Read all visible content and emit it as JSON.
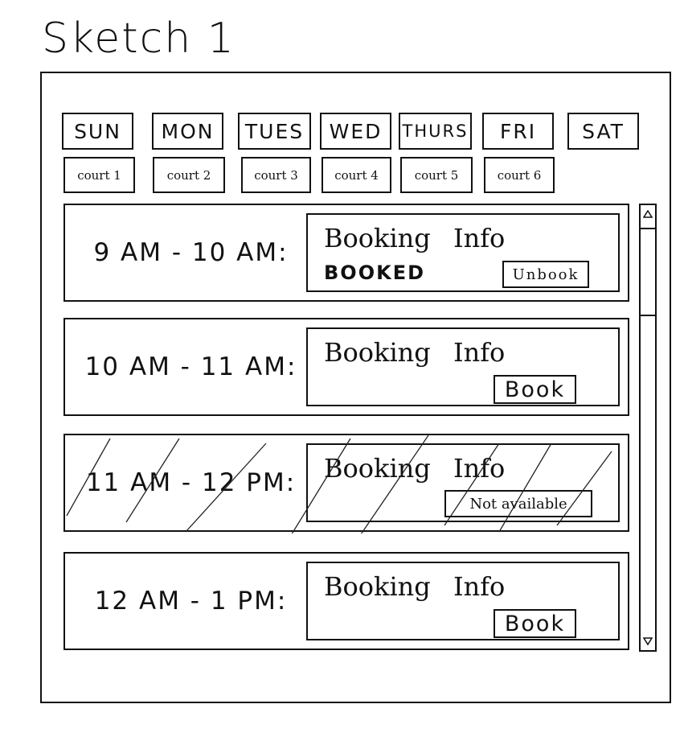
{
  "title": "Sketch 1",
  "days": [
    "SUN",
    "MON",
    "TUES",
    "WED",
    "THURS",
    "FRI",
    "SAT"
  ],
  "courts": [
    "court 1",
    "court 2",
    "court 3",
    "court 4",
    "court 5",
    "court 6"
  ],
  "slots": [
    {
      "time": "9 AM - 10 AM:",
      "info_title": "Booking Info",
      "status": "BOOKED",
      "action": "Unbook"
    },
    {
      "time": "10 AM - 11 AM:",
      "info_title": "Booking Info",
      "status": "",
      "action": "Book"
    },
    {
      "time": "11 AM - 12 PM:",
      "info_title": "Booking Info",
      "status": "",
      "action": "Not available"
    },
    {
      "time": "12 AM - 1 PM:",
      "info_title": "Booking Info",
      "status": "",
      "action": "Book"
    }
  ],
  "scrollbar": {
    "up_icon": "triangle-up-icon",
    "down_icon": "triangle-down-icon"
  }
}
